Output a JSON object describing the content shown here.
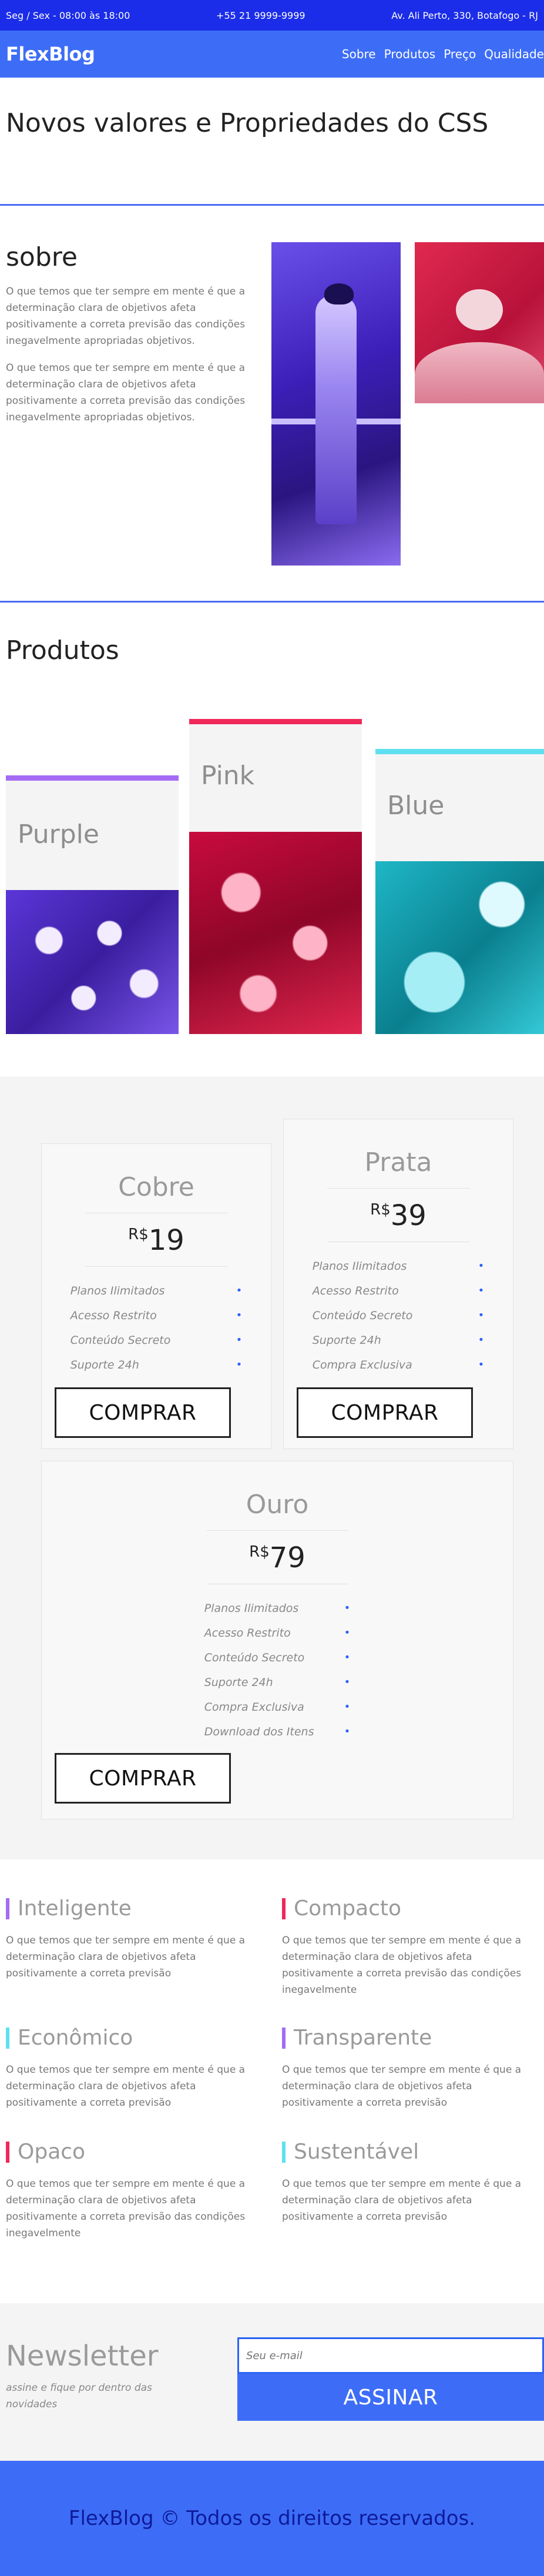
{
  "topbar": {
    "hours": "Seg / Sex - 08:00 às 18:00",
    "phone": "+55 21 9999-9999",
    "address": "Av. Ali Perto, 330, Botafogo - RJ"
  },
  "header": {
    "logo": "FlexBlog",
    "nav": [
      "Sobre",
      "Produtos",
      "Preço",
      "Qualidade"
    ]
  },
  "intro": {
    "title": "Novos valores e Propriedades do CSS"
  },
  "about": {
    "title": "sobre",
    "p1": "O que temos que ter sempre em mente é que a determinação clara de objetivos afeta positivamente a correta previsão das condições inegavelmente apropriadas objetivos.",
    "p2": "O que temos que ter sempre em mente é que a determinação clara de objetivos afeta positivamente a correta previsão das condições inegavelmente apropriadas objetivos."
  },
  "products": {
    "title": "Produtos",
    "items": [
      {
        "label": "Purple",
        "accent": "#a46bf5"
      },
      {
        "label": "Pink",
        "accent": "#f0285a"
      },
      {
        "label": "Blue",
        "accent": "#5ee0f0"
      }
    ]
  },
  "pricing": {
    "currency": "R$",
    "buy_label": "COMPRAR",
    "plans": [
      {
        "name": "Cobre",
        "price": "19",
        "features": [
          "Planos Ilimitados",
          "Acesso Restrito",
          "Conteúdo Secreto",
          "Suporte 24h"
        ]
      },
      {
        "name": "Prata",
        "price": "39",
        "features": [
          "Planos Ilimitados",
          "Acesso Restrito",
          "Conteúdo Secreto",
          "Suporte 24h",
          "Compra Exclusiva"
        ]
      },
      {
        "name": "Ouro",
        "price": "79",
        "features": [
          "Planos Ilimitados",
          "Acesso Restrito",
          "Conteúdo Secreto",
          "Suporte 24h",
          "Compra Exclusiva",
          "Download dos Itens"
        ]
      }
    ]
  },
  "features": [
    {
      "title": "Inteligente",
      "text": "O que temos que ter sempre em mente é que a determinação clara de objetivos afeta positivamente a correta previsão"
    },
    {
      "title": "Compacto",
      "text": "O que temos que ter sempre em mente é que a determinação clara de objetivos afeta positivamente a correta previsão das condições inegavelmente"
    },
    {
      "title": "Econômico",
      "text": "O que temos que ter sempre em mente é que a determinação clara de objetivos afeta positivamente a correta previsão"
    },
    {
      "title": "Transparente",
      "text": "O que temos que ter sempre em mente é que a determinação clara de objetivos afeta positivamente a correta previsão"
    },
    {
      "title": "Opaco",
      "text": "O que temos que ter sempre em mente é que a determinação clara de objetivos afeta positivamente a correta previsão das condições inegavelmente"
    },
    {
      "title": "Sustentável",
      "text": "O que temos que ter sempre em mente é que a determinação clara de objetivos afeta positivamente a correta previsão"
    }
  ],
  "newsletter": {
    "title": "Newsletter",
    "subtitle": "assine e fique por dentro das novidades",
    "placeholder": "Seu e-mail",
    "button": "ASSINAR"
  },
  "footer": {
    "text": "FlexBlog © Todos os direitos reservados."
  },
  "colors": {
    "primary": "#3d6df7",
    "purple": "#a46bf5",
    "pink": "#f0285a",
    "blue": "#5ee0f0"
  }
}
